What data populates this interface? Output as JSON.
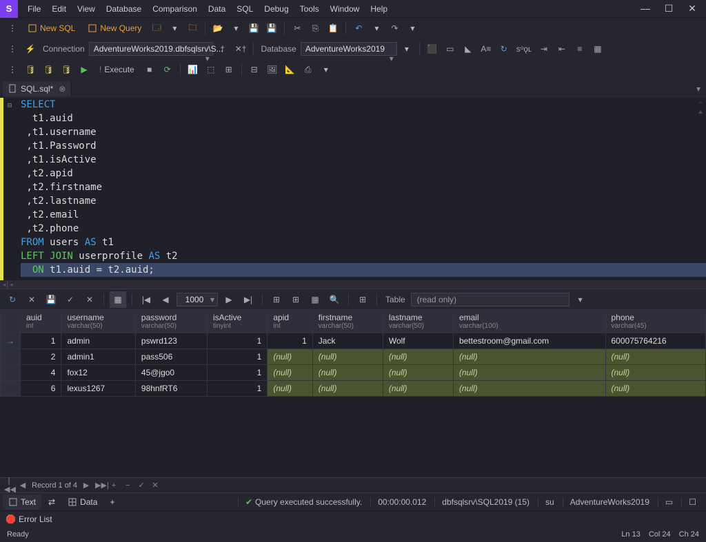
{
  "menu": [
    "File",
    "Edit",
    "View",
    "Database",
    "Comparison",
    "Data",
    "SQL",
    "Debug",
    "Tools",
    "Window",
    "Help"
  ],
  "toolbar1": {
    "newSql": "New SQL",
    "newQuery": "New Query"
  },
  "toolbar2": {
    "connLabel": "Connection",
    "connValue": "AdventureWorks2019.dbfsqlsrv\\S...",
    "dbLabel": "Database",
    "dbValue": "AdventureWorks2019"
  },
  "toolbar3": {
    "execute": "Execute"
  },
  "tabs": {
    "sql": "SQL.sql*"
  },
  "code": {
    "l1_kw": "SELECT",
    "l2": "  t1.auid",
    "l3": " ,t1.username",
    "l4": " ,t1.Password",
    "l5": " ,t1.isActive",
    "l6": " ,t2.apid",
    "l7": " ,t2.firstname",
    "l8": " ,t2.lastname",
    "l9": " ,t2.email",
    "l10": " ,t2.phone",
    "l11a": "FROM",
    "l11b": " users ",
    "l11c": "AS",
    "l11d": " t1",
    "l12a": "LEFT JOIN",
    "l12b": " userprofile ",
    "l12c": "AS",
    "l12d": " t2",
    "l13a": "  ON",
    "l13b": " t1.auid = t2.auid;"
  },
  "results": {
    "pageSize": "1000",
    "tableLabel": "Table",
    "readonly": "(read only)"
  },
  "columns": [
    {
      "name": "auid",
      "type": "int",
      "rightAlign": true
    },
    {
      "name": "username",
      "type": "varchar(50)"
    },
    {
      "name": "password",
      "type": "varchar(50)"
    },
    {
      "name": "isActive",
      "type": "tinyint",
      "rightAlign": true
    },
    {
      "name": "apid",
      "type": "int",
      "rightAlign": true
    },
    {
      "name": "firstname",
      "type": "varchar(50)"
    },
    {
      "name": "lastname",
      "type": "varchar(50)"
    },
    {
      "name": "email",
      "type": "varchar(100)"
    },
    {
      "name": "phone",
      "type": "varchar(45)"
    }
  ],
  "rows": [
    {
      "active": true,
      "cells": [
        "1",
        "admin",
        "pswrd123",
        "1",
        "1",
        "Jack",
        "Wolf",
        "bettestroom@gmail.com",
        "600075764216"
      ]
    },
    {
      "cells": [
        "2",
        "admin1",
        "pass506",
        "1",
        null,
        null,
        null,
        null,
        null
      ]
    },
    {
      "cells": [
        "4",
        "fox12",
        "45@jgo0",
        "1",
        null,
        null,
        null,
        null,
        null
      ]
    },
    {
      "cells": [
        "6",
        "lexus1267",
        "98hnfRT6",
        "1",
        null,
        null,
        null,
        null,
        null
      ]
    }
  ],
  "recnav": "Record 1 of 4",
  "bottom": {
    "text": "Text",
    "data": "Data",
    "status": "Query executed successfully.",
    "time": "00:00:00.012",
    "server": "dbfsqlsrv\\SQL2019 (15)",
    "user": "su",
    "db": "AdventureWorks2019"
  },
  "errorList": "Error List",
  "status": {
    "ready": "Ready",
    "ln": "Ln 13",
    "col": "Col 24",
    "ch": "Ch 24"
  },
  "null": "(null)"
}
